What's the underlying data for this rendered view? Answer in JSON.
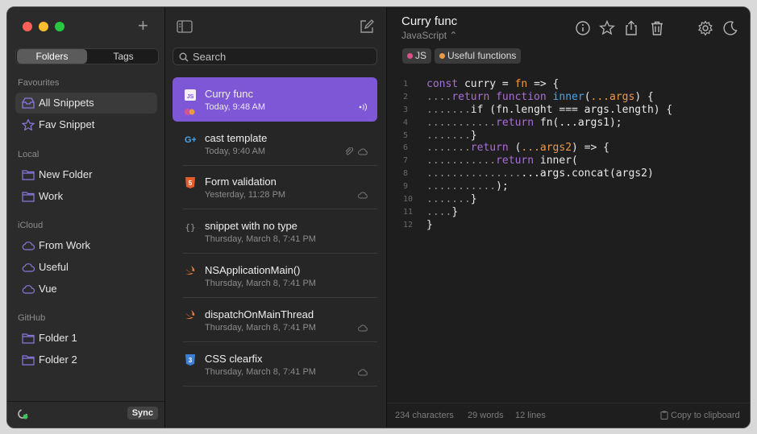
{
  "colors": {
    "accent": "#7d57d6",
    "keyword": "#a86fd6",
    "func": "#ee9944",
    "ident": "#4fa3e6",
    "dots": "#8c8c8c",
    "text": "#e8e8e8"
  },
  "sidebar": {
    "add_icon": "plus-icon",
    "segments": {
      "folders": "Folders",
      "tags": "Tags"
    },
    "sections": [
      {
        "title": "Favourites",
        "items": [
          {
            "label": "All Snippets",
            "icon": "tray-icon"
          },
          {
            "label": "Fav Snippet",
            "icon": "star-icon"
          }
        ]
      },
      {
        "title": "Local",
        "items": [
          {
            "label": "New Folder",
            "icon": "folder-icon"
          },
          {
            "label": "Work",
            "icon": "folder-icon"
          }
        ]
      },
      {
        "title": "iCloud",
        "items": [
          {
            "label": "From Work",
            "icon": "cloud-icon"
          },
          {
            "label": "Useful",
            "icon": "cloud-icon"
          },
          {
            "label": "Vue",
            "icon": "cloud-icon"
          }
        ]
      },
      {
        "title": "GitHub",
        "items": [
          {
            "label": "Folder 1",
            "icon": "folder-icon"
          },
          {
            "label": "Folder 2",
            "icon": "folder-icon"
          }
        ]
      }
    ],
    "sync_label": "Sync"
  },
  "list": {
    "search_placeholder": "Search",
    "snippets": [
      {
        "title": "Curry func",
        "date": "Today, 9:48 AM",
        "icon": "js-icon"
      },
      {
        "title": "cast template",
        "date": "Today, 9:40 AM",
        "icon": "google-plus-icon"
      },
      {
        "title": "Form validation",
        "date": "Yesterday, 11:28 PM",
        "icon": "html5-icon"
      },
      {
        "title": "snippet with no type",
        "date": "Thursday, March 8, 7:41 PM",
        "icon": "braces-icon"
      },
      {
        "title": "NSApplicationMain()",
        "date": "Thursday, March 8, 7:41 PM",
        "icon": "swift-icon"
      },
      {
        "title": "dispatchOnMainThread",
        "date": "Thursday, March 8, 7:41 PM",
        "icon": "swift-icon"
      },
      {
        "title": "CSS clearfix",
        "date": "Thursday, March 8, 7:41 PM",
        "icon": "css3-icon"
      }
    ]
  },
  "editor": {
    "title": "Curry func",
    "language": "JavaScript ⌃",
    "tags": [
      {
        "label": "JS",
        "color": "#e0508a"
      },
      {
        "label": "Useful functions",
        "color": "#ee9944"
      }
    ],
    "code_lines": [
      [
        [
          "k",
          "const "
        ],
        [
          "t",
          "curry = "
        ],
        [
          "f",
          "fn"
        ],
        [
          "t",
          " => {"
        ]
      ],
      [
        [
          "d",
          "...."
        ],
        [
          "k",
          "return function "
        ],
        [
          "i",
          "inner"
        ],
        [
          "t",
          "("
        ],
        [
          "f",
          "...args"
        ],
        [
          "t",
          ") {"
        ]
      ],
      [
        [
          "d",
          "......."
        ],
        [
          "t",
          "if (fn.lenght === args.length) {"
        ]
      ],
      [
        [
          "d",
          "..........."
        ],
        [
          "k",
          "return "
        ],
        [
          "t",
          "fn(...args1);"
        ]
      ],
      [
        [
          "d",
          "......."
        ],
        [
          "t",
          "}"
        ]
      ],
      [
        [
          "d",
          "......."
        ],
        [
          "k",
          "return "
        ],
        [
          "t",
          "("
        ],
        [
          "f",
          "...args2"
        ],
        [
          "t",
          ") => {"
        ]
      ],
      [
        [
          "d",
          "..........."
        ],
        [
          "k",
          "return "
        ],
        [
          "t",
          "inner("
        ]
      ],
      [
        [
          "d",
          "..............."
        ],
        [
          "t",
          "...args.concat(args2)"
        ]
      ],
      [
        [
          "d",
          "..........."
        ],
        [
          "t",
          ");"
        ]
      ],
      [
        [
          "d",
          "......."
        ],
        [
          "t",
          "}"
        ]
      ],
      [
        [
          "d",
          "...."
        ],
        [
          "t",
          "}"
        ]
      ],
      [
        [
          "t",
          "}"
        ]
      ]
    ],
    "footer": {
      "chars": "234 characters",
      "words": "29 words",
      "lines": "12 lines",
      "copy": "Copy to clipboard"
    }
  }
}
